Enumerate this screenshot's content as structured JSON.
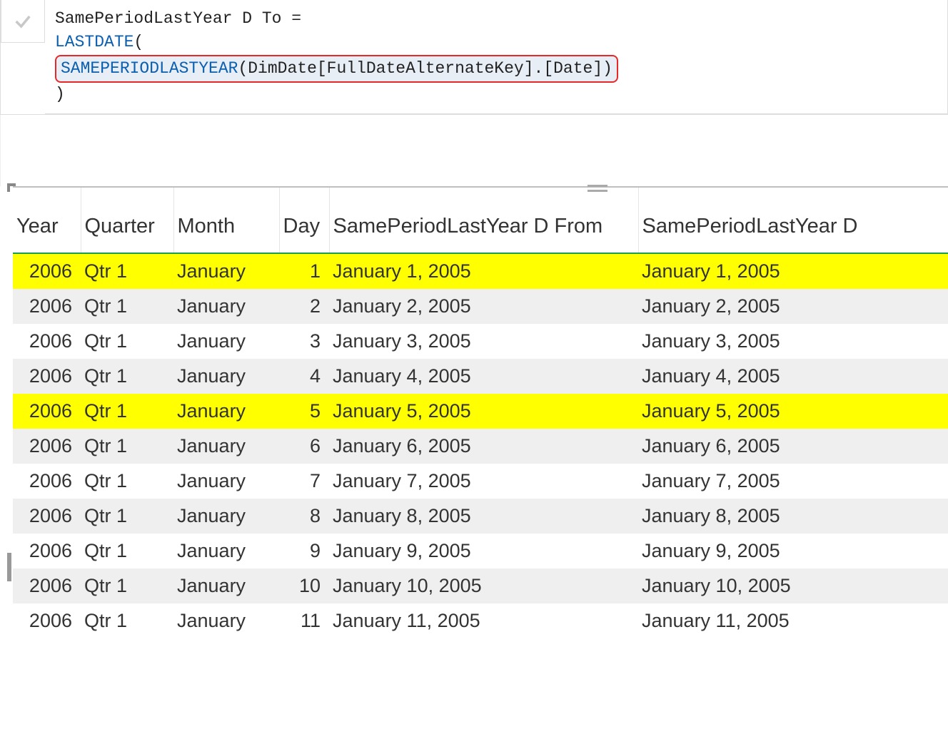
{
  "formula": {
    "line1": "SamePeriodLastYear D To =",
    "line2_func": "LASTDATE",
    "line2_paren": "(",
    "line3_func": "SAMEPERIODLASTYEAR",
    "line3_args": "(DimDate[FullDateAlternateKey].[Date])",
    "line4": ")"
  },
  "table": {
    "headers": {
      "year": "Year",
      "quarter": "Quarter",
      "month": "Month",
      "day": "Day",
      "from": "SamePeriodLastYear D From",
      "to": "SamePeriodLastYear D"
    },
    "rows": [
      {
        "year": "2006",
        "quarter": "Qtr 1",
        "month": "January",
        "day": "1",
        "from": "January 1, 2005",
        "to": "January 1, 2005",
        "highlight": true
      },
      {
        "year": "2006",
        "quarter": "Qtr 1",
        "month": "January",
        "day": "2",
        "from": "January 2, 2005",
        "to": "January 2, 2005",
        "highlight": false
      },
      {
        "year": "2006",
        "quarter": "Qtr 1",
        "month": "January",
        "day": "3",
        "from": "January 3, 2005",
        "to": "January 3, 2005",
        "highlight": false
      },
      {
        "year": "2006",
        "quarter": "Qtr 1",
        "month": "January",
        "day": "4",
        "from": "January 4, 2005",
        "to": "January 4, 2005",
        "highlight": false
      },
      {
        "year": "2006",
        "quarter": "Qtr 1",
        "month": "January",
        "day": "5",
        "from": "January 5, 2005",
        "to": "January 5, 2005",
        "highlight": true
      },
      {
        "year": "2006",
        "quarter": "Qtr 1",
        "month": "January",
        "day": "6",
        "from": "January 6, 2005",
        "to": "January 6, 2005",
        "highlight": false
      },
      {
        "year": "2006",
        "quarter": "Qtr 1",
        "month": "January",
        "day": "7",
        "from": "January 7, 2005",
        "to": "January 7, 2005",
        "highlight": false
      },
      {
        "year": "2006",
        "quarter": "Qtr 1",
        "month": "January",
        "day": "8",
        "from": "January 8, 2005",
        "to": "January 8, 2005",
        "highlight": false
      },
      {
        "year": "2006",
        "quarter": "Qtr 1",
        "month": "January",
        "day": "9",
        "from": "January 9, 2005",
        "to": "January 9, 2005",
        "highlight": false
      },
      {
        "year": "2006",
        "quarter": "Qtr 1",
        "month": "January",
        "day": "10",
        "from": "January 10, 2005",
        "to": "January 10, 2005",
        "highlight": false
      },
      {
        "year": "2006",
        "quarter": "Qtr 1",
        "month": "January",
        "day": "11",
        "from": "January 11, 2005",
        "to": "January 11, 2005",
        "highlight": false
      }
    ]
  }
}
